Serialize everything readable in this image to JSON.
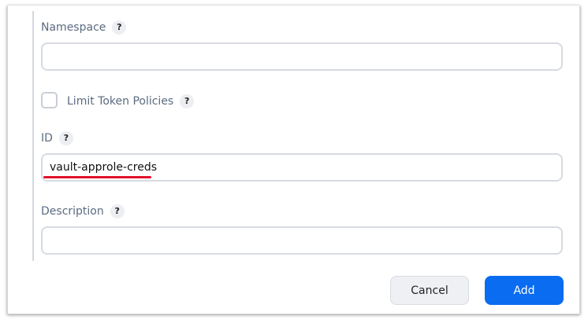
{
  "form": {
    "namespace": {
      "label": "Namespace",
      "help": "?",
      "value": ""
    },
    "limit_token_policies": {
      "label": "Limit Token Policies",
      "help": "?",
      "checked": false
    },
    "id": {
      "label": "ID",
      "help": "?",
      "value": "vault-approle-creds"
    },
    "description": {
      "label": "Description",
      "help": "?",
      "value": ""
    }
  },
  "actions": {
    "cancel_label": "Cancel",
    "add_label": "Add"
  },
  "colors": {
    "primary": "#0a6cf0",
    "annotation_underline": "#e3132a",
    "label": "#5b6b80"
  }
}
